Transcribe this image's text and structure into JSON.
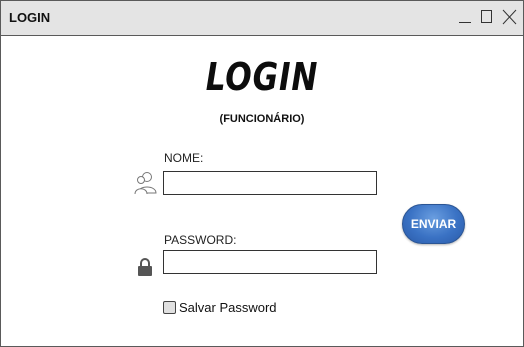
{
  "window": {
    "title": "LOGIN",
    "controls": [
      "minimize",
      "maximize",
      "close"
    ]
  },
  "header": {
    "title": "LOGIN",
    "subtitle": "(FUNCIONÁRIO)"
  },
  "form": {
    "name_label": "NOME:",
    "name_value": "",
    "password_label": "PASSWORD:",
    "password_value": "",
    "submit_label": "ENVIAR",
    "remember_label": "Salvar Password",
    "remember_checked": false
  },
  "icons": {
    "user": "user-icon",
    "lock": "lock-icon"
  },
  "colors": {
    "titlebar": "#e4e4e4",
    "button": "#3a72c4",
    "button_text": "#ffffff"
  }
}
